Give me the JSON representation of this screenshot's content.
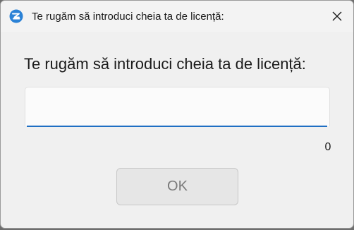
{
  "window": {
    "title": "Te rugăm să introduci cheia ta de licență:",
    "app_icon": "refresh-sync-logo-icon",
    "close_icon": "close-icon"
  },
  "dialog": {
    "prompt": "Te rugăm să introduci cheia ta de licență:",
    "license_input": {
      "value": "",
      "placeholder": ""
    },
    "char_count": "0",
    "ok_label": "OK",
    "ok_enabled": false
  },
  "colors": {
    "accent": "#1f6fc3",
    "icon_blue": "#2b82d6",
    "window_bg": "#f0f0f0",
    "button_disabled_text": "#7a7a7a"
  }
}
